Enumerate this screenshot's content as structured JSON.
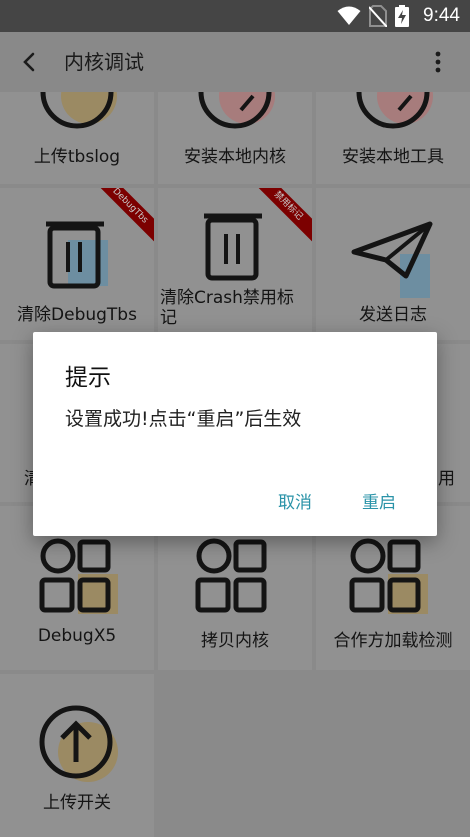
{
  "status": {
    "time": "9:44",
    "icons": [
      "wifi-icon",
      "no-sim-icon",
      "battery-charging-icon"
    ]
  },
  "app_bar": {
    "title": "内核调试"
  },
  "grid": {
    "row0": [
      "上传tbslog",
      "安装本地内核",
      "安装本地工具"
    ],
    "row1": [
      "清除DebugTbs",
      "清除Crash禁用标记",
      "发送日志"
    ],
    "row1_ribbons": [
      "DebugTbs",
      "禁用标记"
    ],
    "row2_partial": [
      "清",
      "用"
    ],
    "row3": [
      "DebugX5",
      "拷贝内核",
      "合作方加载检测"
    ],
    "row4": [
      "上传开关"
    ]
  },
  "dialog": {
    "title": "提示",
    "message": "设置成功!点击“重启”后生效",
    "cancel": "取消",
    "restart": "重启"
  }
}
